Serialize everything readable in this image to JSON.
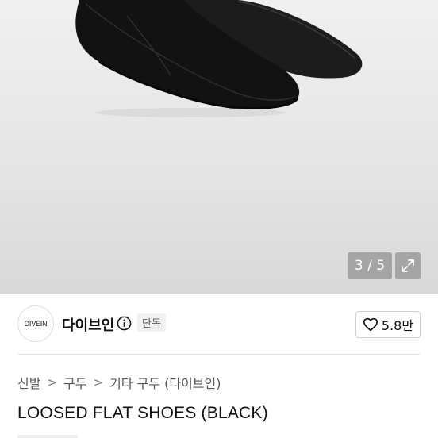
{
  "gallery": {
    "counter": "3 / 5",
    "icons": {
      "expand": "expand-arrows-icon"
    }
  },
  "seller": {
    "logo_text": "DIVEIN",
    "name": "다이브인",
    "badge": "단독",
    "likes": "5.8만",
    "icons": {
      "info": "info-circle-icon",
      "like": "heart-outline-icon"
    }
  },
  "breadcrumb": {
    "items": [
      "신발",
      "구두",
      "기타 구두 (다이브인)"
    ],
    "separator": ">"
  },
  "product": {
    "title": "LOOSED FLAT SHOES (BLACK)"
  },
  "colors": {
    "background": "#ffffff",
    "gallery_bg": "#e6e6e6",
    "overlay": "#8a8a8a",
    "text": "#111111",
    "muted": "#555555"
  }
}
